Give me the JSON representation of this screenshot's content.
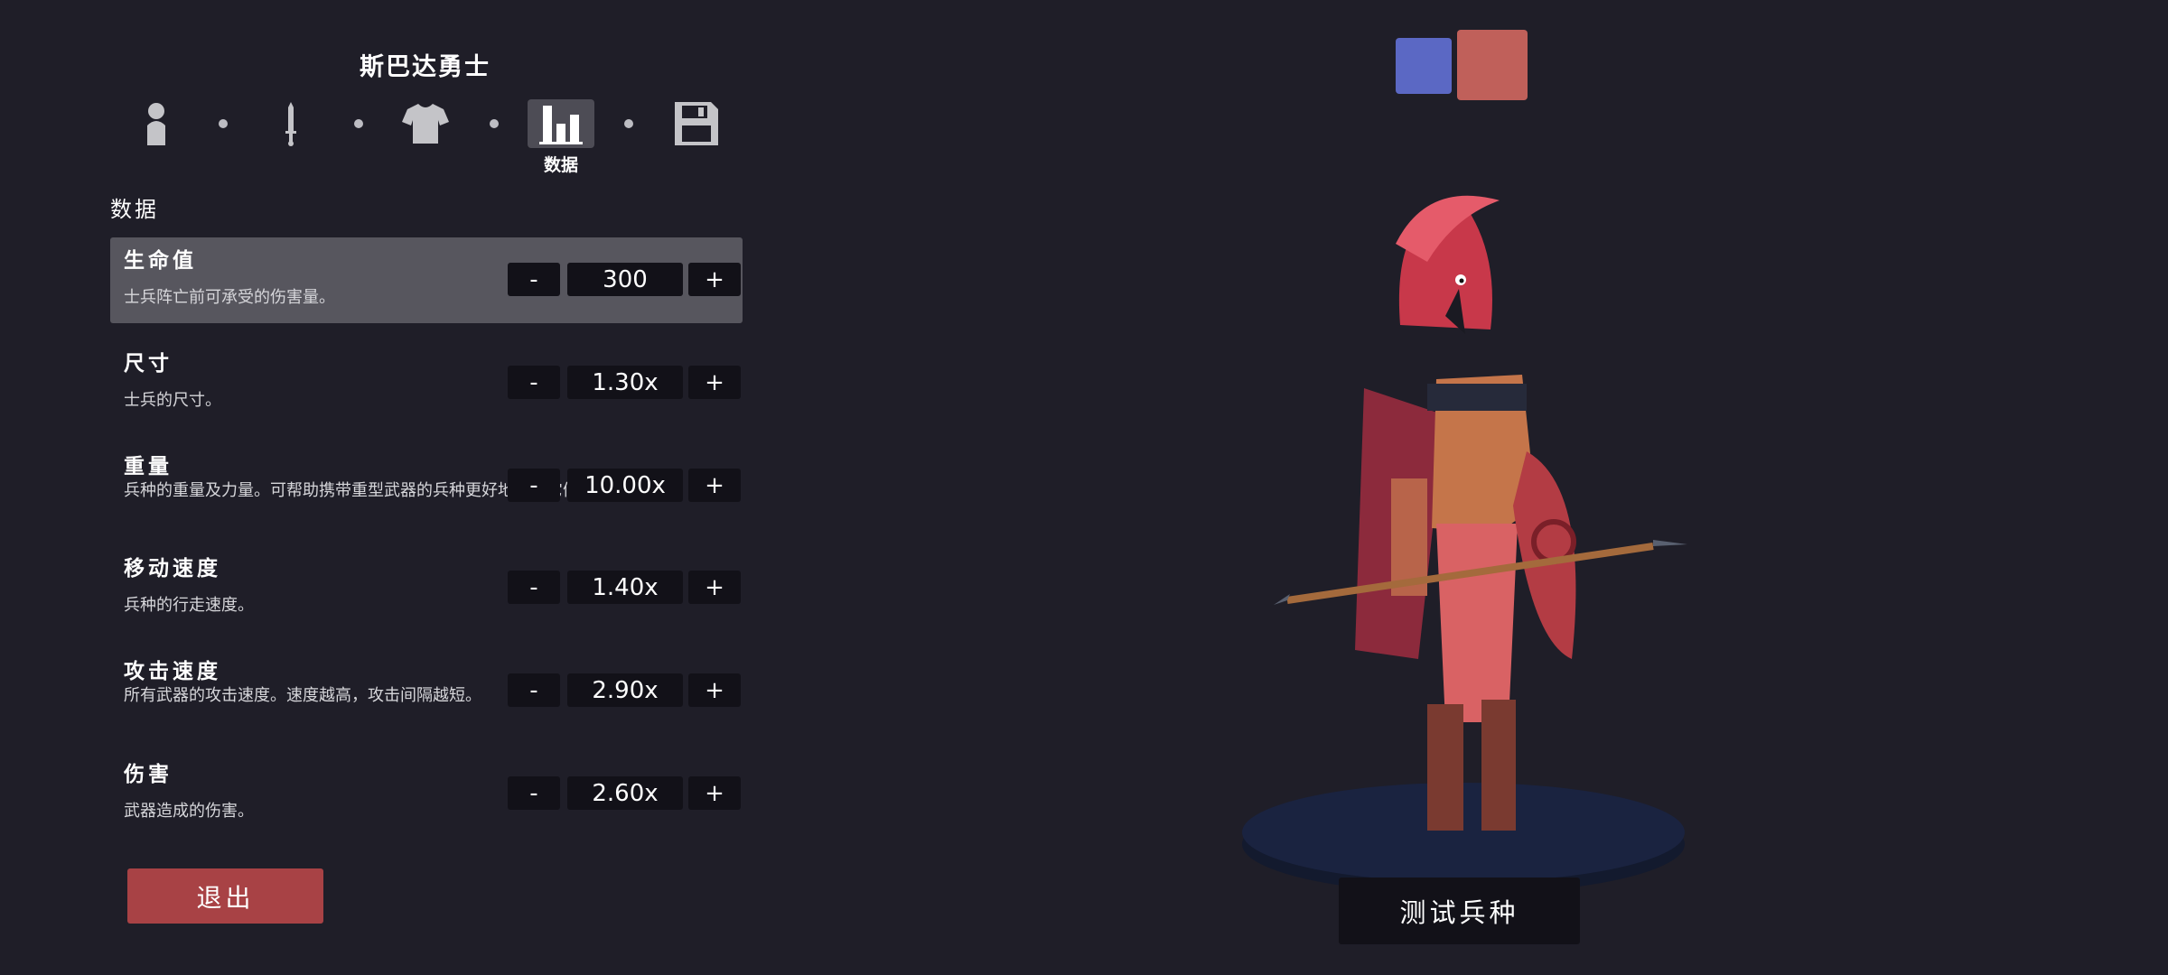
{
  "unit": {
    "name": "斯巴达勇士"
  },
  "steps": {
    "icons": [
      "person-icon",
      "sword-icon",
      "shirt-icon",
      "stats-icon",
      "save-icon"
    ],
    "active_label": "数据"
  },
  "section": {
    "title": "数据"
  },
  "stats": [
    {
      "name": "生命值",
      "desc": "士兵阵亡前可承受的伤害量。",
      "value": "300",
      "minus": "-",
      "plus": "+"
    },
    {
      "name": "尺寸",
      "desc": "士兵的尺寸。",
      "value": "1.30x",
      "minus": "-",
      "plus": "+"
    },
    {
      "name": "重量",
      "desc": "兵种的重量及力量。可帮助携带重型武器的兵种更好地使用它们。",
      "value": "10.00x",
      "minus": "-",
      "plus": "+"
    },
    {
      "name": "移动速度",
      "desc": "兵种的行走速度。",
      "value": "1.40x",
      "minus": "-",
      "plus": "+"
    },
    {
      "name": "攻击速度",
      "desc": "所有武器的攻击速度。速度越高，攻击间隔越短。",
      "value": "2.90x",
      "minus": "-",
      "plus": "+"
    },
    {
      "name": "伤害",
      "desc": "武器造成的伤害。",
      "value": "2.60x",
      "minus": "-",
      "plus": "+"
    }
  ],
  "buttons": {
    "exit": "退出",
    "test_unit": "测试兵种"
  },
  "colors": {
    "team_blue": "#5b68c4",
    "team_red": "#c0605a",
    "accent_red": "#a84245"
  }
}
